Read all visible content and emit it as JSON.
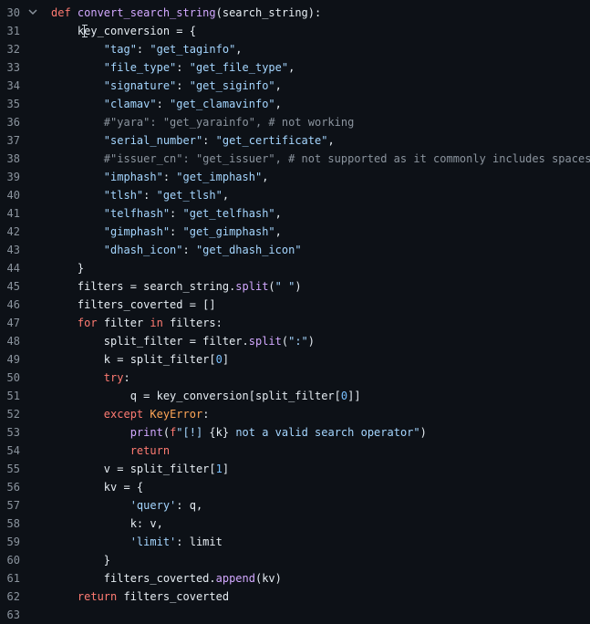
{
  "editor": {
    "lines": [
      {
        "num": "30",
        "fold": true,
        "tokens": [
          {
            "t": "def ",
            "c": "kw"
          },
          {
            "t": "convert_search_string",
            "c": "fn"
          },
          {
            "t": "(search_string):",
            "c": "ident"
          }
        ]
      },
      {
        "num": "31",
        "tokens": [
          {
            "t": "    key_conversion = {",
            "c": "ident"
          }
        ]
      },
      {
        "num": "32",
        "tokens": [
          {
            "t": "        ",
            "c": "ident"
          },
          {
            "t": "\"tag\"",
            "c": "str"
          },
          {
            "t": ": ",
            "c": "ident"
          },
          {
            "t": "\"get_taginfo\"",
            "c": "str"
          },
          {
            "t": ",",
            "c": "ident"
          }
        ]
      },
      {
        "num": "33",
        "tokens": [
          {
            "t": "        ",
            "c": "ident"
          },
          {
            "t": "\"file_type\"",
            "c": "str"
          },
          {
            "t": ": ",
            "c": "ident"
          },
          {
            "t": "\"get_file_type\"",
            "c": "str"
          },
          {
            "t": ",",
            "c": "ident"
          }
        ]
      },
      {
        "num": "34",
        "tokens": [
          {
            "t": "        ",
            "c": "ident"
          },
          {
            "t": "\"signature\"",
            "c": "str"
          },
          {
            "t": ": ",
            "c": "ident"
          },
          {
            "t": "\"get_siginfo\"",
            "c": "str"
          },
          {
            "t": ",",
            "c": "ident"
          }
        ]
      },
      {
        "num": "35",
        "tokens": [
          {
            "t": "        ",
            "c": "ident"
          },
          {
            "t": "\"clamav\"",
            "c": "str"
          },
          {
            "t": ": ",
            "c": "ident"
          },
          {
            "t": "\"get_clamavinfo\"",
            "c": "str"
          },
          {
            "t": ",",
            "c": "ident"
          }
        ]
      },
      {
        "num": "36",
        "tokens": [
          {
            "t": "        ",
            "c": "ident"
          },
          {
            "t": "#\"yara\": \"get_yarainfo\", # not working",
            "c": "cmt"
          }
        ]
      },
      {
        "num": "37",
        "tokens": [
          {
            "t": "        ",
            "c": "ident"
          },
          {
            "t": "\"serial_number\"",
            "c": "str"
          },
          {
            "t": ": ",
            "c": "ident"
          },
          {
            "t": "\"get_certificate\"",
            "c": "str"
          },
          {
            "t": ",",
            "c": "ident"
          }
        ]
      },
      {
        "num": "38",
        "tokens": [
          {
            "t": "        ",
            "c": "ident"
          },
          {
            "t": "#\"issuer_cn\": \"get_issuer\", # not supported as it commonly includes spaceses",
            "c": "cmt"
          }
        ]
      },
      {
        "num": "39",
        "tokens": [
          {
            "t": "        ",
            "c": "ident"
          },
          {
            "t": "\"imphash\"",
            "c": "str"
          },
          {
            "t": ": ",
            "c": "ident"
          },
          {
            "t": "\"get_imphash\"",
            "c": "str"
          },
          {
            "t": ",",
            "c": "ident"
          }
        ]
      },
      {
        "num": "40",
        "tokens": [
          {
            "t": "        ",
            "c": "ident"
          },
          {
            "t": "\"tlsh\"",
            "c": "str"
          },
          {
            "t": ": ",
            "c": "ident"
          },
          {
            "t": "\"get_tlsh\"",
            "c": "str"
          },
          {
            "t": ",",
            "c": "ident"
          }
        ]
      },
      {
        "num": "41",
        "tokens": [
          {
            "t": "        ",
            "c": "ident"
          },
          {
            "t": "\"telfhash\"",
            "c": "str"
          },
          {
            "t": ": ",
            "c": "ident"
          },
          {
            "t": "\"get_telfhash\"",
            "c": "str"
          },
          {
            "t": ",",
            "c": "ident"
          }
        ]
      },
      {
        "num": "42",
        "tokens": [
          {
            "t": "        ",
            "c": "ident"
          },
          {
            "t": "\"gimphash\"",
            "c": "str"
          },
          {
            "t": ": ",
            "c": "ident"
          },
          {
            "t": "\"get_gimphash\"",
            "c": "str"
          },
          {
            "t": ",",
            "c": "ident"
          }
        ]
      },
      {
        "num": "43",
        "tokens": [
          {
            "t": "        ",
            "c": "ident"
          },
          {
            "t": "\"dhash_icon\"",
            "c": "str"
          },
          {
            "t": ": ",
            "c": "ident"
          },
          {
            "t": "\"get_dhash_icon\"",
            "c": "str"
          }
        ]
      },
      {
        "num": "44",
        "tokens": [
          {
            "t": "    }",
            "c": "ident"
          }
        ]
      },
      {
        "num": "45",
        "tokens": [
          {
            "t": "    filters = search_string.",
            "c": "ident"
          },
          {
            "t": "split",
            "c": "fn"
          },
          {
            "t": "(",
            "c": "ident"
          },
          {
            "t": "\" \"",
            "c": "str"
          },
          {
            "t": ")",
            "c": "ident"
          }
        ]
      },
      {
        "num": "46",
        "tokens": [
          {
            "t": "    filters_coverted = []",
            "c": "ident"
          }
        ]
      },
      {
        "num": "47",
        "tokens": [
          {
            "t": "    ",
            "c": "ident"
          },
          {
            "t": "for",
            "c": "kw"
          },
          {
            "t": " filter ",
            "c": "ident"
          },
          {
            "t": "in",
            "c": "kw"
          },
          {
            "t": " filters:",
            "c": "ident"
          }
        ]
      },
      {
        "num": "48",
        "tokens": [
          {
            "t": "        split_filter = filter.",
            "c": "ident"
          },
          {
            "t": "split",
            "c": "fn"
          },
          {
            "t": "(",
            "c": "ident"
          },
          {
            "t": "\":\"",
            "c": "str"
          },
          {
            "t": ")",
            "c": "ident"
          }
        ]
      },
      {
        "num": "49",
        "tokens": [
          {
            "t": "        k = split_filter[",
            "c": "ident"
          },
          {
            "t": "0",
            "c": "num"
          },
          {
            "t": "]",
            "c": "ident"
          }
        ]
      },
      {
        "num": "50",
        "tokens": [
          {
            "t": "        ",
            "c": "ident"
          },
          {
            "t": "try",
            "c": "kw"
          },
          {
            "t": ":",
            "c": "ident"
          }
        ]
      },
      {
        "num": "51",
        "tokens": [
          {
            "t": "            q = key_conversion[split_filter[",
            "c": "ident"
          },
          {
            "t": "0",
            "c": "num"
          },
          {
            "t": "]]",
            "c": "ident"
          }
        ]
      },
      {
        "num": "52",
        "tokens": [
          {
            "t": "        ",
            "c": "ident"
          },
          {
            "t": "except",
            "c": "kw"
          },
          {
            "t": " ",
            "c": "ident"
          },
          {
            "t": "KeyError",
            "c": "cls"
          },
          {
            "t": ":",
            "c": "ident"
          }
        ]
      },
      {
        "num": "53",
        "tokens": [
          {
            "t": "            ",
            "c": "ident"
          },
          {
            "t": "print",
            "c": "fn"
          },
          {
            "t": "(",
            "c": "ident"
          },
          {
            "t": "f",
            "c": "kw"
          },
          {
            "t": "\"[!] ",
            "c": "str"
          },
          {
            "t": "{k}",
            "c": "ident"
          },
          {
            "t": " not a valid search operator\"",
            "c": "str"
          },
          {
            "t": ")",
            "c": "ident"
          }
        ]
      },
      {
        "num": "54",
        "tokens": [
          {
            "t": "            ",
            "c": "ident"
          },
          {
            "t": "return",
            "c": "kw"
          }
        ]
      },
      {
        "num": "55",
        "tokens": [
          {
            "t": "        v = split_filter[",
            "c": "ident"
          },
          {
            "t": "1",
            "c": "num"
          },
          {
            "t": "]",
            "c": "ident"
          }
        ]
      },
      {
        "num": "56",
        "tokens": [
          {
            "t": "        kv = {",
            "c": "ident"
          }
        ]
      },
      {
        "num": "57",
        "tokens": [
          {
            "t": "            ",
            "c": "ident"
          },
          {
            "t": "'query'",
            "c": "str"
          },
          {
            "t": ": q,",
            "c": "ident"
          }
        ]
      },
      {
        "num": "58",
        "tokens": [
          {
            "t": "            k: v,",
            "c": "ident"
          }
        ]
      },
      {
        "num": "59",
        "tokens": [
          {
            "t": "            ",
            "c": "ident"
          },
          {
            "t": "'limit'",
            "c": "str"
          },
          {
            "t": ": limit",
            "c": "ident"
          }
        ]
      },
      {
        "num": "60",
        "tokens": [
          {
            "t": "        }",
            "c": "ident"
          }
        ]
      },
      {
        "num": "61",
        "tokens": [
          {
            "t": "        filters_coverted.",
            "c": "ident"
          },
          {
            "t": "append",
            "c": "fn"
          },
          {
            "t": "(kv)",
            "c": "ident"
          }
        ]
      },
      {
        "num": "62",
        "tokens": [
          {
            "t": "    ",
            "c": "ident"
          },
          {
            "t": "return",
            "c": "kw"
          },
          {
            "t": " filters_coverted",
            "c": "ident"
          }
        ]
      },
      {
        "num": "63",
        "tokens": []
      }
    ],
    "fold_icon": "chevron-down-icon",
    "cursor_icon": "text-cursor-icon"
  },
  "colors": {
    "background": "#0d1117",
    "keyword": "#ff7b72",
    "function": "#d2a8ff",
    "string": "#a5d6ff",
    "comment": "#8b949e",
    "number": "#79c0ff",
    "class": "#ffa657",
    "text": "#e6edf3",
    "line_number": "#8b949e"
  }
}
